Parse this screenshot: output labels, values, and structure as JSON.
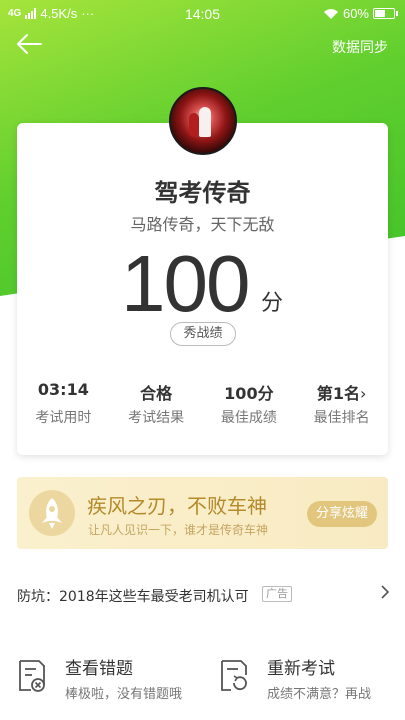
{
  "status_bar": {
    "network": "4G",
    "speed": "4.5K/s",
    "dots": "···",
    "time": "14:05",
    "battery": "60%",
    "battery_level": 0.6
  },
  "header": {
    "back_icon": "arrow-left-icon",
    "sync_label": "数据同步"
  },
  "result_card": {
    "title": "驾考传奇",
    "subtitle": "马路传奇，天下无敌",
    "score": "100",
    "score_unit": "分",
    "show_button": "秀战绩",
    "stats": [
      {
        "value": "03:14",
        "label": "考试用时"
      },
      {
        "value": "合格",
        "label": "考试结果"
      },
      {
        "value": "100分",
        "label": "最佳成绩"
      },
      {
        "value": "第1名",
        "label": "最佳排名",
        "chevron": "›"
      }
    ]
  },
  "share_banner": {
    "icon": "rocket-icon",
    "title": "疾风之刃，不败车神",
    "subtitle": "让凡人见识一下，谁才是传奇车神",
    "button": "分享炫耀"
  },
  "ad": {
    "text": "防坑：2018年这些车最受老司机认可",
    "tag": "广告"
  },
  "actions": [
    {
      "title": "查看错题",
      "subtitle": "棒极啦，没有错题哦",
      "icon": "wrong-questions-icon"
    },
    {
      "title": "重新考试",
      "subtitle": "成绩不满意？再战",
      "icon": "retake-exam-icon"
    }
  ],
  "colors": {
    "accent_green": "#3fc12a",
    "banner_gold": "#b48a2a"
  }
}
